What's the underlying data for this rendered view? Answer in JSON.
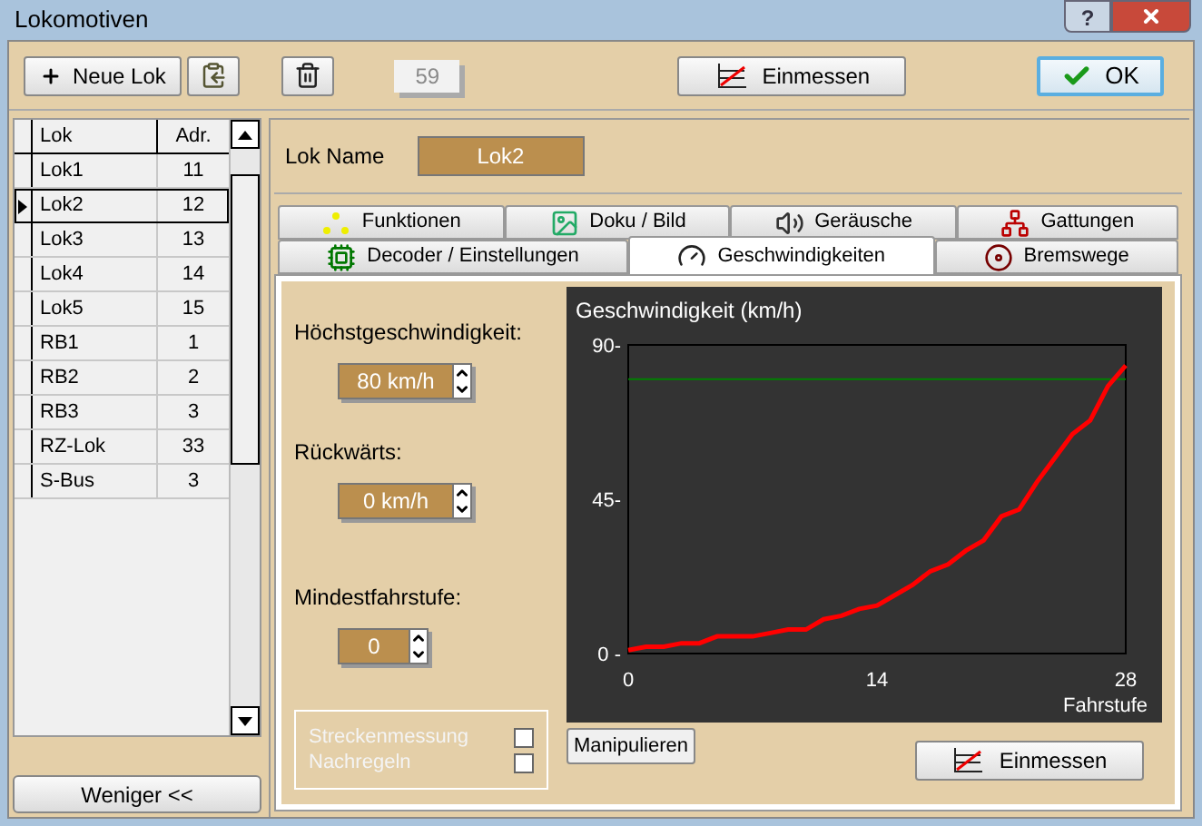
{
  "window": {
    "title": "Lokomotiven",
    "help_label": "?"
  },
  "toolbar": {
    "new_button": "Neue Lok",
    "counter": {
      "text": "59",
      "disabled": true
    },
    "measure_button": "Einmessen",
    "ok_button": "OK"
  },
  "loco_table": {
    "columns": [
      "Lok",
      "Adr."
    ],
    "rows": [
      {
        "name": "Lok1",
        "address": "11",
        "selected": false
      },
      {
        "name": "Lok2",
        "address": "12",
        "selected": true
      },
      {
        "name": "Lok3",
        "address": "13",
        "selected": false
      },
      {
        "name": "Lok4",
        "address": "14",
        "selected": false
      },
      {
        "name": "Lok5",
        "address": "15",
        "selected": false
      },
      {
        "name": "RB1",
        "address": "1",
        "selected": false
      },
      {
        "name": "RB2",
        "address": "2",
        "selected": false
      },
      {
        "name": "RB3",
        "address": "3",
        "selected": false
      },
      {
        "name": "RZ-Lok",
        "address": "33",
        "selected": false
      },
      {
        "name": "S-Bus",
        "address": "3",
        "selected": false
      }
    ]
  },
  "less_button": "Weniger <<",
  "loco_name": {
    "label": "Lok Name",
    "value": "Lok2"
  },
  "tabs_row_1": [
    {
      "label": "Funktionen",
      "kind": "functions",
      "selected": false
    },
    {
      "label": "Doku / Bild",
      "kind": "picture",
      "selected": false
    },
    {
      "label": "Geräusche",
      "kind": "sound",
      "selected": false
    },
    {
      "label": "Gattungen",
      "kind": "classes",
      "selected": false
    }
  ],
  "tabs_row_2": [
    {
      "label": "Decoder / Einstellungen",
      "kind": "decoder",
      "selected": false
    },
    {
      "label": "Geschwindigkeiten",
      "kind": "speed",
      "selected": true
    },
    {
      "label": "Bremswege",
      "kind": "brake",
      "selected": false
    }
  ],
  "speed": {
    "fields": [
      {
        "label": "Höchstgeschwindigkeit:",
        "value": "80 km/h"
      },
      {
        "label": "Rückwärts:",
        "value": "0 km/h"
      },
      {
        "label": "Mindestfahrstufe:",
        "value": "0"
      }
    ],
    "options": [
      {
        "label": "Streckenmessung",
        "checked": false,
        "disabled": true
      },
      {
        "label": "Nachregeln",
        "checked": false,
        "disabled": true
      }
    ],
    "manipulate_button": "Manipulieren",
    "measure_button": "Einmessen",
    "chart_data": {
      "type": "line",
      "title": "Geschwindigkeit (km/h)",
      "xlabel": "Fahrstufe",
      "xlim": [
        0,
        28
      ],
      "ylim": [
        0,
        90
      ],
      "xticks": [
        0,
        14,
        28
      ],
      "yticks": [
        {
          "value": 0,
          "label": "0 -"
        },
        {
          "value": 45,
          "label": "45-"
        },
        {
          "value": 90,
          "label": "90-"
        }
      ],
      "x": [
        0,
        1,
        2,
        3,
        4,
        5,
        6,
        7,
        8,
        9,
        10,
        11,
        12,
        13,
        14,
        15,
        16,
        17,
        18,
        19,
        20,
        21,
        22,
        23,
        24,
        25,
        26,
        27,
        28
      ],
      "series": [
        {
          "color": "#008000",
          "values": [
            80,
            80,
            80,
            80,
            80,
            80,
            80,
            80,
            80,
            80,
            80,
            80,
            80,
            80,
            80,
            80,
            80,
            80,
            80,
            80,
            80,
            80,
            80,
            80,
            80,
            80,
            80,
            80,
            80
          ]
        },
        {
          "color": "#ff0000",
          "values": [
            1,
            2,
            2,
            3,
            3,
            5,
            5,
            5,
            6,
            7,
            7,
            10,
            11,
            13,
            14,
            17,
            20,
            24,
            26,
            30,
            33,
            40,
            42,
            50,
            57,
            64,
            68,
            78,
            84
          ]
        }
      ]
    }
  }
}
